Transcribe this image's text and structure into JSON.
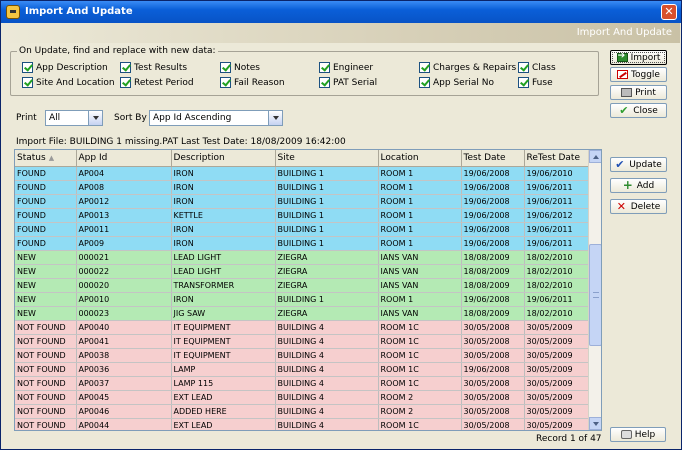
{
  "window": {
    "title": "Import And Update",
    "banner_title": "Import And Update"
  },
  "options": {
    "legend": "On Update, find and replace with new data:",
    "checkboxes": [
      {
        "label": "App Description",
        "checked": true
      },
      {
        "label": "Test Results",
        "checked": true
      },
      {
        "label": "Notes",
        "checked": true
      },
      {
        "label": "Engineer",
        "checked": true
      },
      {
        "label": "Charges & Repairs",
        "checked": true
      },
      {
        "label": "Class",
        "checked": true
      },
      {
        "label": "Site And Location",
        "checked": true
      },
      {
        "label": "Retest Period",
        "checked": true
      },
      {
        "label": "Fail Reason",
        "checked": true
      },
      {
        "label": "PAT Serial",
        "checked": true
      },
      {
        "label": "App Serial No",
        "checked": true
      },
      {
        "label": "Fuse",
        "checked": true
      }
    ]
  },
  "buttons": {
    "import": "Import",
    "toggle": "Toggle",
    "print": "Print",
    "close": "Close",
    "update": "Update",
    "add": "Add",
    "delete": "Delete",
    "help": "Help"
  },
  "filters": {
    "print_label": "Print",
    "print_value": "All",
    "sort_label": "Sort By",
    "sort_value": "App Id Ascending"
  },
  "import_info": "Import File: BUILDING 1 missing.PAT   Last Test Date: 18/08/2009 16:42:00",
  "table": {
    "columns": [
      "Status",
      "App Id",
      "Description",
      "Site",
      "Location",
      "Test Date",
      "ReTest Date"
    ],
    "sort_indicator": "▲",
    "rows": [
      {
        "status": "FOUND",
        "app_id": "AP004",
        "description": "IRON",
        "site": "BUILDING 1",
        "location": "ROOM  1",
        "test_date": "19/06/2008",
        "retest_date": "19/06/2010",
        "kind": "found"
      },
      {
        "status": "FOUND",
        "app_id": "AP008",
        "description": "IRON",
        "site": "BUILDING 1",
        "location": "ROOM  1",
        "test_date": "19/06/2008",
        "retest_date": "19/06/2011",
        "kind": "found"
      },
      {
        "status": "FOUND",
        "app_id": "AP0012",
        "description": "IRON",
        "site": "BUILDING 1",
        "location": "ROOM  1",
        "test_date": "19/06/2008",
        "retest_date": "19/06/2011",
        "kind": "found"
      },
      {
        "status": "FOUND",
        "app_id": "AP0013",
        "description": "KETTLE",
        "site": "BUILDING 1",
        "location": "ROOM  1",
        "test_date": "19/06/2008",
        "retest_date": "19/06/2012",
        "kind": "found"
      },
      {
        "status": "FOUND",
        "app_id": "AP0011",
        "description": "IRON",
        "site": "BUILDING 1",
        "location": "ROOM  1",
        "test_date": "19/06/2008",
        "retest_date": "19/06/2011",
        "kind": "found"
      },
      {
        "status": "FOUND",
        "app_id": "AP009",
        "description": "IRON",
        "site": "BUILDING 1",
        "location": "ROOM  1",
        "test_date": "19/06/2008",
        "retest_date": "19/06/2011",
        "kind": "found"
      },
      {
        "status": "NEW",
        "app_id": "000021",
        "description": "LEAD LIGHT",
        "site": "ZIEGRA",
        "location": "IANS VAN",
        "test_date": "18/08/2009",
        "retest_date": "18/02/2010",
        "kind": "new"
      },
      {
        "status": "NEW",
        "app_id": "000022",
        "description": "LEAD LIGHT",
        "site": "ZIEGRA",
        "location": "IANS VAN",
        "test_date": "18/08/2009",
        "retest_date": "18/02/2010",
        "kind": "new"
      },
      {
        "status": "NEW",
        "app_id": "000020",
        "description": "TRANSFORMER",
        "site": "ZIEGRA",
        "location": "IANS VAN",
        "test_date": "18/08/2009",
        "retest_date": "18/02/2010",
        "kind": "new"
      },
      {
        "status": "NEW",
        "app_id": "AP0010",
        "description": "IRON",
        "site": "BUILDING 1",
        "location": "ROOM  1",
        "test_date": "19/06/2008",
        "retest_date": "19/06/2011",
        "kind": "new"
      },
      {
        "status": "NEW",
        "app_id": "000023",
        "description": "JIG SAW",
        "site": "ZIEGRA",
        "location": "IANS VAN",
        "test_date": "18/08/2009",
        "retest_date": "18/02/2010",
        "kind": "new"
      },
      {
        "status": "NOT FOUND",
        "app_id": "AP0040",
        "description": "IT EQUIPMENT",
        "site": "BUILDING 4",
        "location": "ROOM  1C",
        "test_date": "30/05/2008",
        "retest_date": "30/05/2009",
        "kind": "notfound"
      },
      {
        "status": "NOT FOUND",
        "app_id": "AP0041",
        "description": "IT EQUIPMENT",
        "site": "BUILDING 4",
        "location": "ROOM  1C",
        "test_date": "30/05/2008",
        "retest_date": "30/05/2009",
        "kind": "notfound"
      },
      {
        "status": "NOT FOUND",
        "app_id": "AP0038",
        "description": "IT EQUIPMENT",
        "site": "BUILDING 4",
        "location": "ROOM  1C",
        "test_date": "30/05/2008",
        "retest_date": "30/05/2009",
        "kind": "notfound"
      },
      {
        "status": "NOT FOUND",
        "app_id": "AP0036",
        "description": "LAMP",
        "site": "BUILDING 4",
        "location": "ROOM  1C",
        "test_date": "19/06/2008",
        "retest_date": "30/05/2009",
        "kind": "notfound"
      },
      {
        "status": "NOT FOUND",
        "app_id": "AP0037",
        "description": "LAMP 115",
        "site": "BUILDING 4",
        "location": "ROOM  1C",
        "test_date": "30/05/2008",
        "retest_date": "30/05/2009",
        "kind": "notfound"
      },
      {
        "status": "NOT FOUND",
        "app_id": "AP0045",
        "description": "EXT LEAD",
        "site": "BUILDING 4",
        "location": "ROOM  2",
        "test_date": "30/05/2008",
        "retest_date": "30/05/2009",
        "kind": "notfound"
      },
      {
        "status": "NOT FOUND",
        "app_id": "AP0046",
        "description": "ADDED HERE",
        "site": "BUILDING 4",
        "location": "ROOM  2",
        "test_date": "30/05/2008",
        "retest_date": "30/05/2009",
        "kind": "notfound"
      },
      {
        "status": "NOT FOUND",
        "app_id": "AP0044",
        "description": "EXT LEAD",
        "site": "BUILDING 4",
        "location": "ROOM  1C",
        "test_date": "30/05/2008",
        "retest_date": "30/05/2009",
        "kind": "notfound"
      }
    ]
  },
  "record_status": "Record 1 of 47",
  "colors": {
    "found": "#8fdcf4",
    "new": "#b4eab4",
    "not_found": "#f6cfcf",
    "titlebar": "#0853c6"
  },
  "icons": {
    "import": "import-arrow-icon",
    "toggle": "toggle-icon",
    "print": "printer-icon",
    "close": "checkmark-icon",
    "update": "checkmark-icon",
    "add": "plus-icon",
    "delete": "x-icon",
    "help": "help-icon",
    "app": "app-icon",
    "window_close": "close-icon"
  }
}
